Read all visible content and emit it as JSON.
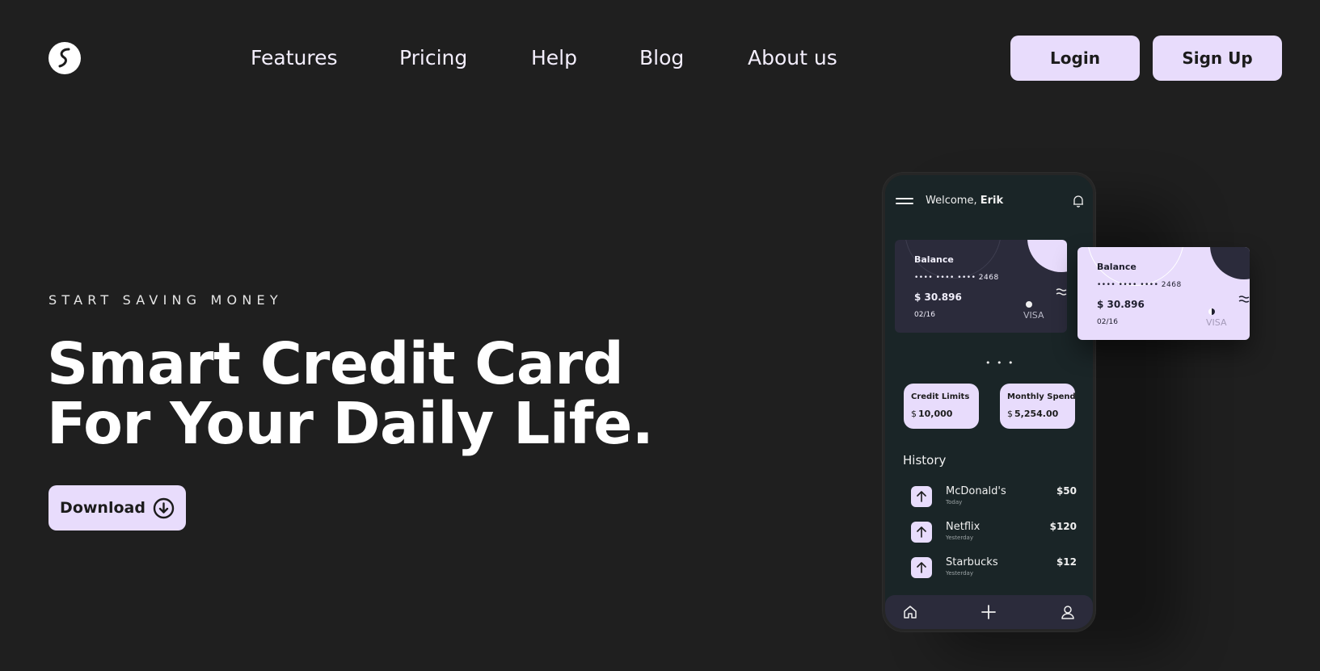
{
  "header": {
    "nav": [
      {
        "label": "Features"
      },
      {
        "label": "Pricing"
      },
      {
        "label": "Help"
      },
      {
        "label": "Blog"
      },
      {
        "label": "About us"
      }
    ],
    "login_label": "Login",
    "signup_label": "Sign Up"
  },
  "hero": {
    "eyebrow": "START SAVING MONEY",
    "headline_line1": "Smart Credit Card",
    "headline_line2": "For Your Daily Life.",
    "download_label": "Download"
  },
  "phone": {
    "welcome_prefix": "Welcome, ",
    "welcome_name": "Erik",
    "pager": "• • •",
    "cards": [
      {
        "title": "Balance",
        "number": "•••• •••• •••• 2468",
        "balance": "$ 30.896",
        "expiry": "02/16",
        "brand": "VISA"
      },
      {
        "title": "Balance",
        "number": "•••• •••• •••• 2468",
        "balance": "$ 30.896",
        "expiry": "02/16",
        "brand": "VISA"
      }
    ],
    "stats": [
      {
        "label": "Credit Limits",
        "currency": "$",
        "value": "10,000"
      },
      {
        "label": "Monthly Spend",
        "currency": "$",
        "value": "5,254.00"
      }
    ],
    "history_title": "History",
    "history": [
      {
        "name": "McDonald's",
        "when": "Today",
        "amount": "$50"
      },
      {
        "name": "Netflix",
        "when": "Yesterday",
        "amount": "$120"
      },
      {
        "name": "Starbucks",
        "when": "Yesterday",
        "amount": "$12"
      }
    ]
  },
  "colors": {
    "background": "#1f1f1f",
    "accent": "#e8dcfc",
    "phone_body": "#1a2527",
    "card_dark": "#2b2b3b"
  },
  "icons": [
    "logo-icon",
    "menu-icon",
    "bell-icon",
    "download-circle-icon",
    "arrow-up-icon",
    "home-icon",
    "plus-icon",
    "user-icon",
    "wave-icon"
  ]
}
